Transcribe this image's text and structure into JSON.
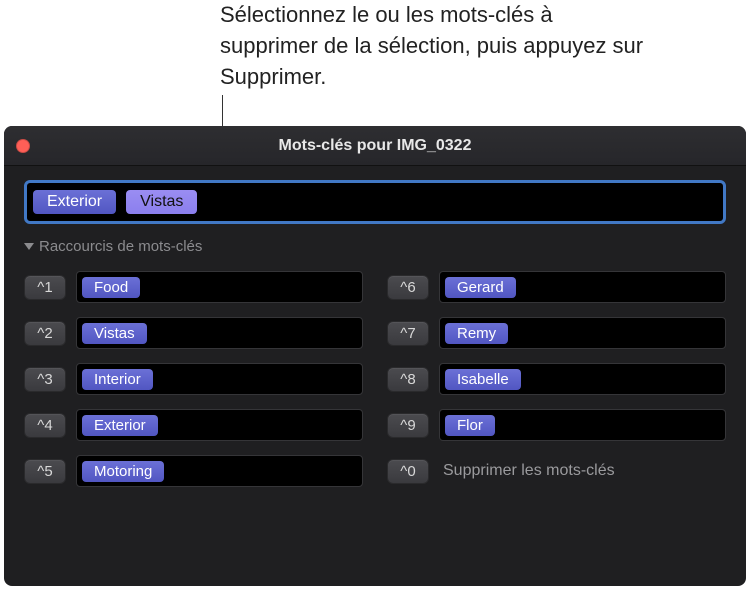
{
  "callout": "Sélectionnez le ou les mots-clés à supprimer de la sélection, puis appuyez sur Supprimer.",
  "window": {
    "title": "Mots-clés pour IMG_0322"
  },
  "applied_keywords": [
    {
      "label": "Exterior",
      "selected": false
    },
    {
      "label": "Vistas",
      "selected": true
    }
  ],
  "section_header": "Raccourcis de mots-clés",
  "shortcuts": {
    "left": [
      {
        "key": "^1",
        "label": "Food"
      },
      {
        "key": "^2",
        "label": "Vistas"
      },
      {
        "key": "^3",
        "label": "Interior"
      },
      {
        "key": "^4",
        "label": "Exterior"
      },
      {
        "key": "^5",
        "label": "Motoring"
      }
    ],
    "right": [
      {
        "key": "^6",
        "label": "Gerard"
      },
      {
        "key": "^7",
        "label": "Remy"
      },
      {
        "key": "^8",
        "label": "Isabelle"
      },
      {
        "key": "^9",
        "label": "Flor"
      }
    ],
    "remove": {
      "key": "^0",
      "label": "Supprimer les mots-clés"
    }
  }
}
